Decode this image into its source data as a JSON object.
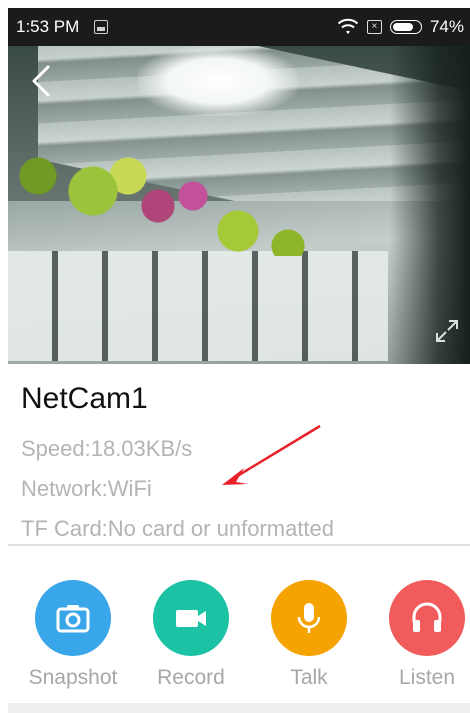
{
  "status_bar": {
    "time": "1:53 PM",
    "battery": "74%"
  },
  "camera": {
    "name": "NetCam1",
    "speed": "Speed:18.03KB/s",
    "network": "Network:WiFi",
    "tf_card": "TF Card:No card or unformatted"
  },
  "actions": [
    {
      "label": "Snapshot",
      "icon": "camera-icon",
      "color": "#3aa6ea"
    },
    {
      "label": "Record",
      "icon": "video-icon",
      "color": "#1bc3a4"
    },
    {
      "label": "Talk",
      "icon": "microphone-icon",
      "color": "#f5a300"
    },
    {
      "label": "Listen",
      "icon": "headphones-icon",
      "color": "#f25b5b"
    }
  ],
  "colors": {
    "status_bar": "#1b1b1b",
    "secondary_text": "#b4b4b4",
    "annotation_arrow": "#e8202a"
  }
}
